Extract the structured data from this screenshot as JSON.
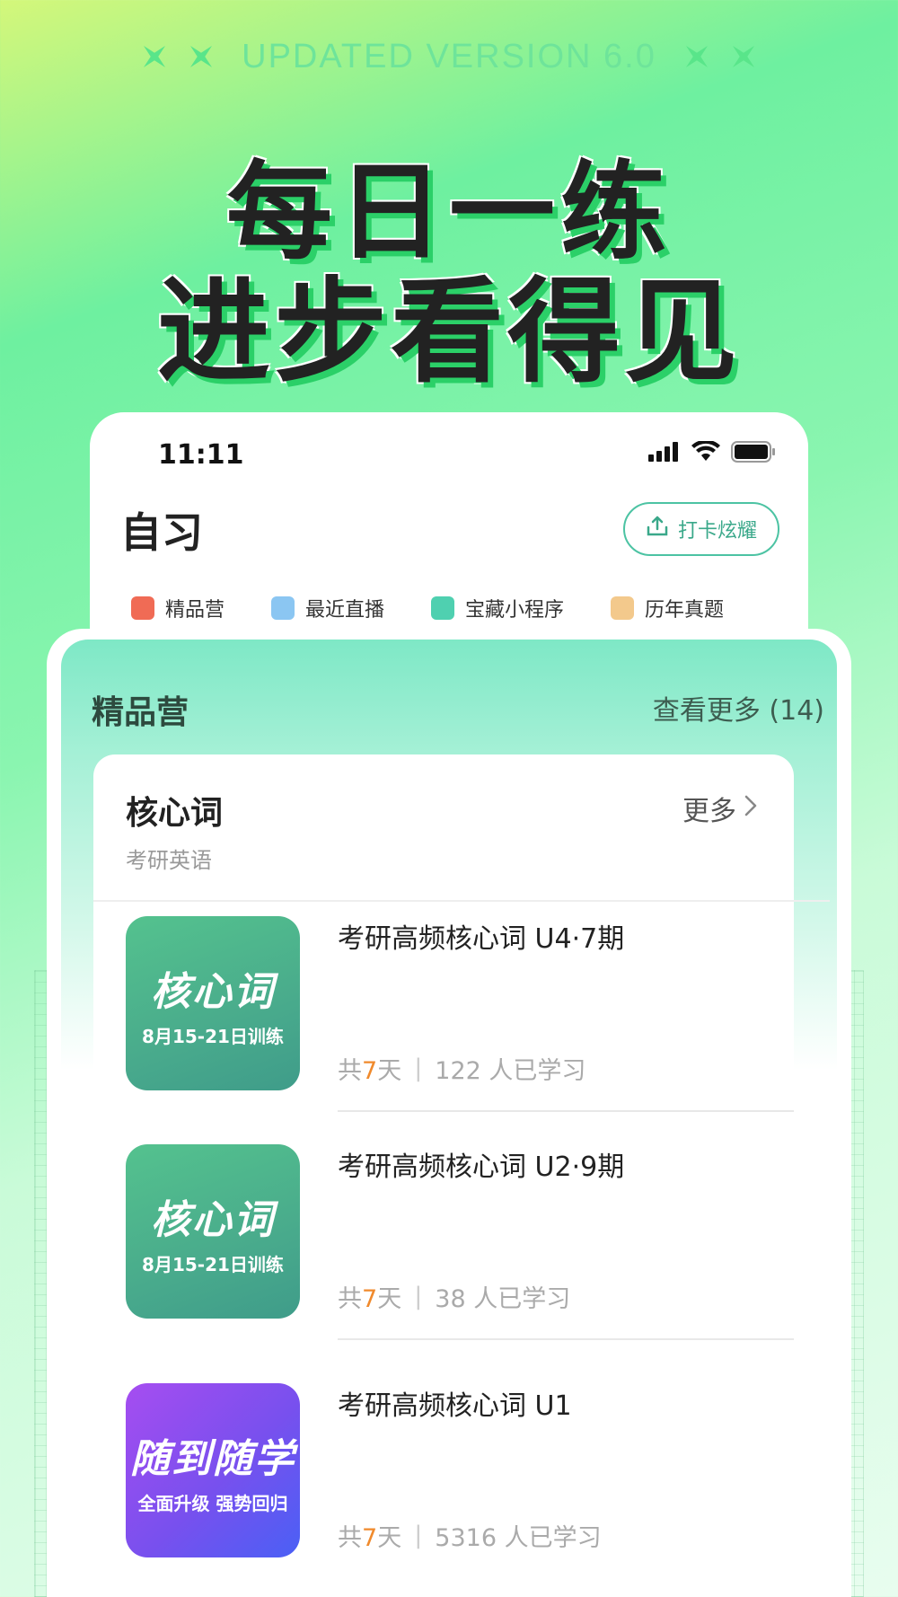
{
  "banner": {
    "version_text": "UPDATED VERSION 6.0"
  },
  "headline": {
    "line1": "每日一练",
    "line2": "进步看得见"
  },
  "status_bar": {
    "time": "11:11"
  },
  "page": {
    "title": "自习",
    "checkin_label": "打卡炫耀"
  },
  "tabs": [
    {
      "label": "精品营",
      "icon": "camp-icon",
      "color": "#f06b55"
    },
    {
      "label": "最近直播",
      "icon": "live-video-icon",
      "color": "#8bc6f2"
    },
    {
      "label": "宝藏小程序",
      "icon": "miniprogram-icon",
      "color": "#4fd0b0"
    },
    {
      "label": "历年真题",
      "icon": "folder-icon",
      "color": "#f3c98c"
    }
  ],
  "section": {
    "title": "精品营",
    "see_more": "查看更多 (14)"
  },
  "category": {
    "title": "核心词",
    "subtitle": "考研英语",
    "more": "更多"
  },
  "courses": [
    {
      "title": "考研高频核心词 U4·7期",
      "thumb_main": "核心词",
      "thumb_sub": "8月15-21日训练",
      "days_prefix": "共",
      "days": "7",
      "days_suffix": "天",
      "learners": "122 人已学习"
    },
    {
      "title": "考研高频核心词 U2·9期",
      "thumb_main": "核心词",
      "thumb_sub": "8月15-21日训练",
      "days_prefix": "共",
      "days": "7",
      "days_suffix": "天",
      "learners": "38 人已学习"
    },
    {
      "title": "考研高频核心词 U1",
      "thumb_main": "随到随学",
      "thumb_sub": "全面升级 强势回归",
      "days_prefix": "共",
      "days": "7",
      "days_suffix": "天",
      "learners": "5316 人已学习"
    }
  ],
  "colors": {
    "accent_green": "#4cc3a3",
    "highlight_orange": "#f08a2c"
  }
}
